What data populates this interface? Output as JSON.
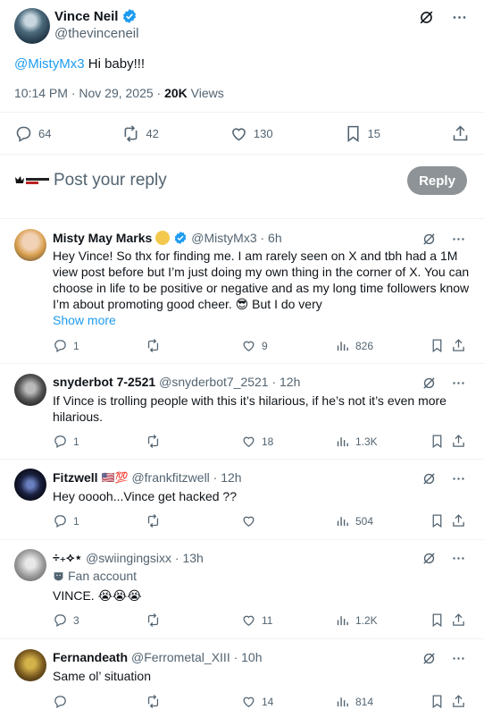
{
  "main_tweet": {
    "author_name": "Vince Neil",
    "author_handle": "@thevinceneil",
    "mention": "@MistyMx3",
    "text": " Hi baby!!!",
    "time": "10:14 PM · Nov 29, 2025 · ",
    "views_count": "20K",
    "views_label": " Views",
    "replies": "64",
    "reposts": "42",
    "likes": "130",
    "bookmarks": "15"
  },
  "reply_box": {
    "placeholder": "Post your reply",
    "button_label": "Reply"
  },
  "replies": [
    {
      "name": "Misty May Marks",
      "handle": "@MistyMx3 · 6h",
      "text": "Hey Vince! So thx for finding me. I am rarely seen on X and tbh had a 1M view post before but I’m just doing my own thing in the corner of X. You can choose in life to be positive or negative and as my long time followers know I’m about promoting good cheer. 😎 But I do very",
      "show_more": "Show more",
      "replies": "1",
      "reposts": "",
      "likes": "9",
      "views": "826"
    },
    {
      "name": "snyderbot 7-2521",
      "handle": "@snyderbot7_2521 · 12h",
      "text": "If Vince is trolling people with this it’s hilarious, if he’s not it’s even more hilarious.",
      "replies": "1",
      "reposts": "",
      "likes": "18",
      "views": "1.3K"
    },
    {
      "name": "Fitzwell",
      "flag_emoji": "🇺🇸💯",
      "handle": "@frankfitzwell · 12h",
      "text": "Hey ooooh...Vince get hacked ??",
      "replies": "1",
      "reposts": "",
      "likes": "",
      "views": "504"
    },
    {
      "name": "÷₊⟡⋆",
      "handle": "@swiingingsixx · 13h",
      "label": "Fan account",
      "text": "VINCE. 😭😭😭",
      "replies": "3",
      "reposts": "",
      "likes": "11",
      "views": "1.2K"
    },
    {
      "name": "Fernandeath",
      "handle": "@Ferrometal_XIII · 10h",
      "text": "Same ol’ situation",
      "replies": "",
      "reposts": "",
      "likes": "14",
      "views": "814"
    }
  ],
  "colors": {
    "accent": "#1d9bf0",
    "text_secondary": "#536471",
    "reply_button": "#8d9396",
    "divider": "#eff3f4"
  },
  "icons": [
    "verified-badge-icon",
    "grok-icon",
    "more-icon",
    "reply-icon",
    "repost-icon",
    "like-icon",
    "bookmark-icon",
    "share-icon",
    "views-icon",
    "fan-account-icon"
  ]
}
